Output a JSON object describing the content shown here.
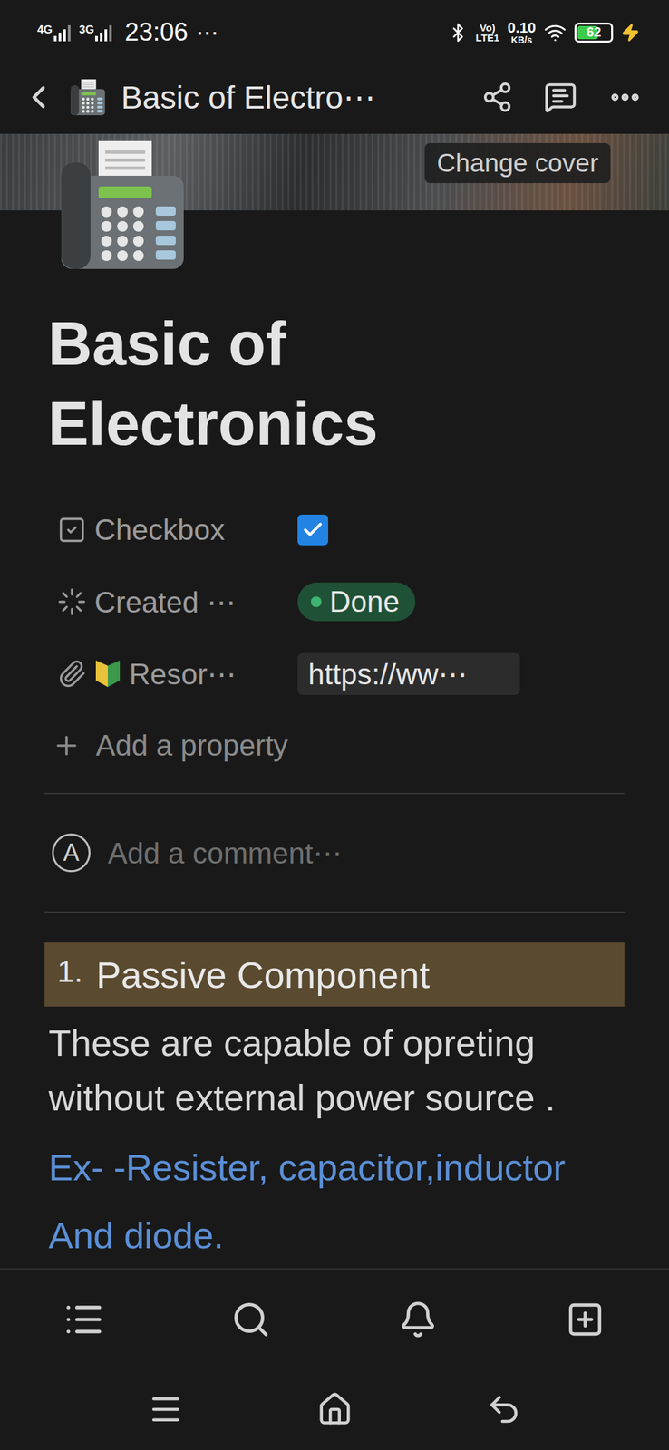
{
  "status_bar": {
    "networks": [
      "4G",
      "3G"
    ],
    "time": "23:06",
    "more": "⋯",
    "volte": [
      "Vo)",
      "LTE1"
    ],
    "speed": {
      "value": "0.10",
      "unit": "KB/s"
    },
    "battery": {
      "text": "62",
      "level": 0.62,
      "charging": true
    }
  },
  "nav": {
    "title": "Basic of Electro⋯"
  },
  "cover": {
    "button": "Change cover"
  },
  "page": {
    "title": "Basic of Electronics"
  },
  "properties": [
    {
      "label": "Checkbox",
      "kind": "checkbox",
      "checked": true
    },
    {
      "label": "Created ⋯",
      "kind": "status",
      "value": "Done",
      "color": "#3fb370"
    },
    {
      "label": "Resor⋯",
      "kind": "url",
      "value": "https://ww⋯"
    }
  ],
  "add_property": "Add a property",
  "comment": {
    "avatar": "A",
    "placeholder": "Add a comment⋯"
  },
  "blocks": [
    {
      "kind": "heading",
      "number": "1.",
      "lines": [
        "Passive Component"
      ]
    },
    {
      "kind": "paragraph",
      "lines": [
        "These are capable of opreting",
        "without external power source ."
      ]
    },
    {
      "kind": "link",
      "lines": [
        "Ex- -Resister, capacitor,inductor",
        "And diode."
      ]
    }
  ]
}
